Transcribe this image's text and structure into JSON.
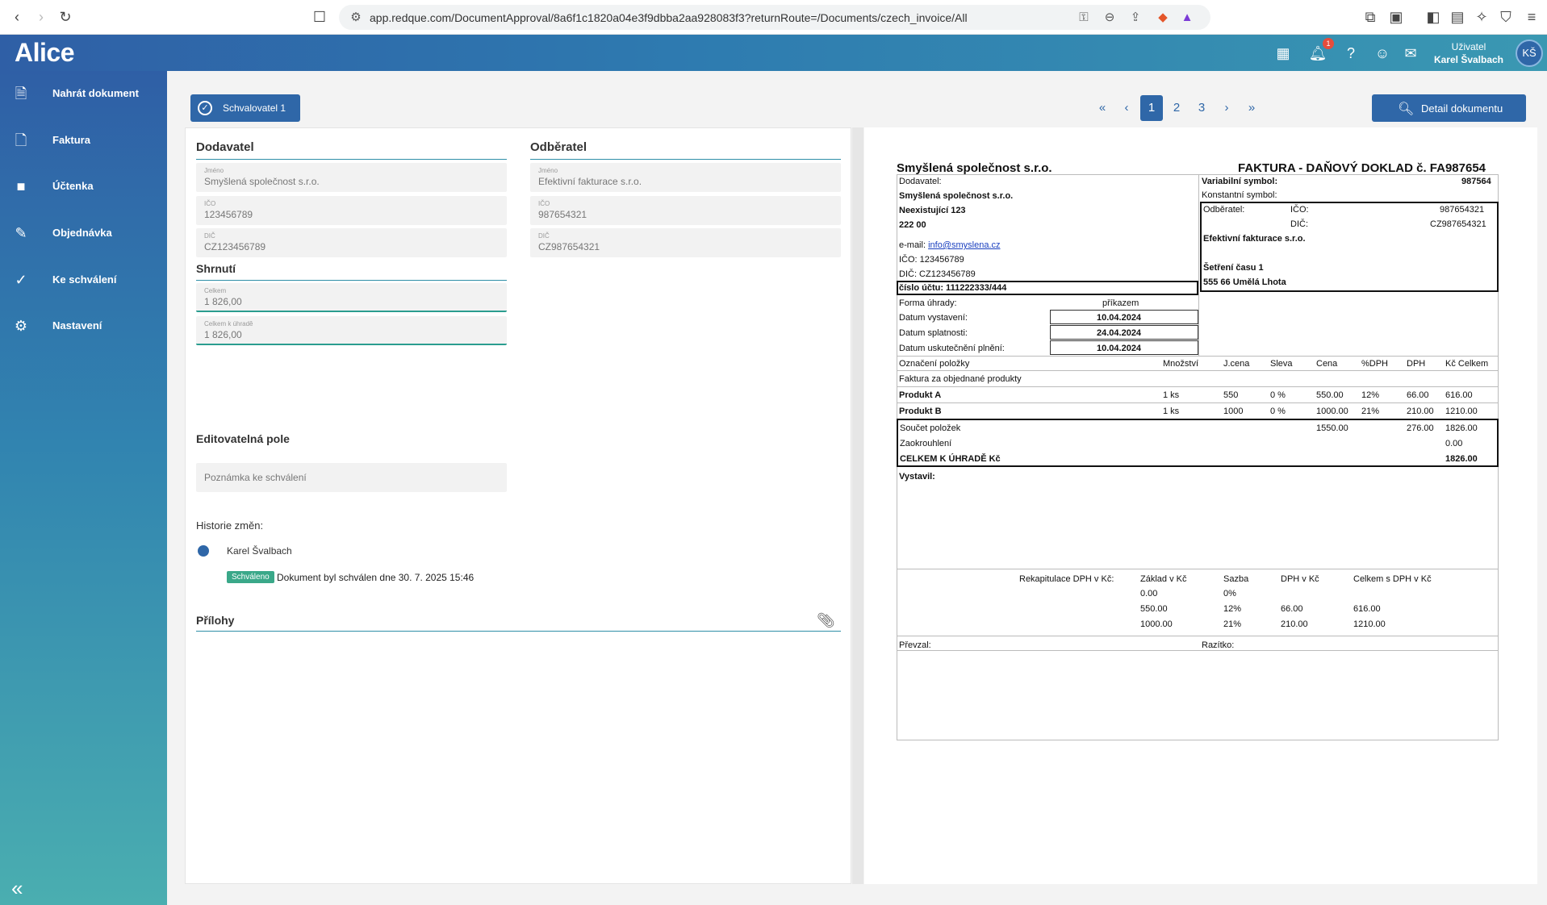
{
  "browser": {
    "url": "app.redque.com/DocumentApproval/8a6f1c1820a04e3f9dbba2aa928083f3?returnRoute=/Documents/czech_invoice/All"
  },
  "header": {
    "logo": "Alice",
    "notification_count": "1",
    "user_role": "Uživatel",
    "user_name": "Karel Švalbach",
    "user_initials": "KŠ"
  },
  "sidebar": {
    "items": [
      {
        "label": "Nahrát dokument",
        "icon": "upload-file-icon"
      },
      {
        "label": "Faktura",
        "icon": "document-icon"
      },
      {
        "label": "Účtenka",
        "icon": "receipt-icon"
      },
      {
        "label": "Objednávka",
        "icon": "order-edit-icon"
      },
      {
        "label": "Ke schválení",
        "icon": "approval-document-icon"
      },
      {
        "label": "Nastavení",
        "icon": "gear-icon"
      }
    ]
  },
  "toolbar": {
    "approver_label": "Schvalovatel 1",
    "pages": [
      "1",
      "2",
      "3"
    ],
    "active_page": "1",
    "detail_label": "Detail dokumentu"
  },
  "form": {
    "supplier": {
      "title": "Dodavatel",
      "fields": [
        {
          "label": "Jméno",
          "value": "Smyšlená společnost s.r.o."
        },
        {
          "label": "IČO",
          "value": "123456789"
        },
        {
          "label": "DIČ",
          "value": "CZ123456789"
        }
      ]
    },
    "customer": {
      "title": "Odběratel",
      "fields": [
        {
          "label": "Jméno",
          "value": "Efektivní fakturace s.r.o."
        },
        {
          "label": "IČO",
          "value": "987654321"
        },
        {
          "label": "DIČ",
          "value": "CZ987654321"
        }
      ]
    },
    "summary": {
      "title": "Shrnutí",
      "fields": [
        {
          "label": "Celkem",
          "value": "1  826,00"
        },
        {
          "label": "Celkem k úhradě",
          "value": "1  826,00"
        }
      ]
    },
    "editable": {
      "title": "Editovatelná pole",
      "note_placeholder": "Poznámka ke schválení"
    },
    "history": {
      "title": "Historie změn:",
      "user": "Karel Švalbach",
      "badge": "Schváleno",
      "message": "Dokument byl schválen dne 30. 7. 2025 15:46"
    },
    "attachments": {
      "title": "Přílohy"
    }
  },
  "invoice": {
    "company": "Smyšlená společnost s.r.o.",
    "title": "FAKTURA - DAŇOVÝ DOKLAD č. FA987654",
    "supplier_label": "Dodavatel:",
    "supplier_name": "Smyšlená společnost s.r.o.",
    "supplier_street": "Neexistující 123",
    "supplier_zip": "222 00",
    "email_label": "e-mail:",
    "email": "info@smyslena.cz",
    "ico_line": "IČO: 123456789",
    "dic_line": "DIČ: CZ123456789",
    "account": "číslo účtu: 111222333/444",
    "vs_label": "Variabilní symbol:",
    "vs_value": "987564",
    "ks_label": "Konstantní symbol:",
    "cust_label": "Odběratel:",
    "cust_ico_label": "IČO:",
    "cust_ico": "987654321",
    "cust_dic_label": "DIČ:",
    "cust_dic": "CZ987654321",
    "cust_name": "Efektivní fakturace s.r.o.",
    "cust_street": "Šetření času 1",
    "cust_city": "555 66 Umělá Lhota",
    "payment_label": "Forma úhrady:",
    "payment_value": "příkazem",
    "issue_label": "Datum vystavení:",
    "issue_date": "10.04.2024",
    "due_label": "Datum splatnosti:",
    "due_date": "24.04.2024",
    "taxable_label": "Datum uskutečnění plnění:",
    "taxable_date": "10.04.2024",
    "columns": [
      "Označení položky",
      "Množství",
      "J.cena",
      "Sleva",
      "Cena",
      "%DPH",
      "DPH",
      "Kč Celkem"
    ],
    "intro": "Faktura za objednané produkty",
    "items": [
      {
        "name": "Produkt A",
        "qty": "1 ks",
        "unit": "550",
        "disc": "0 %",
        "price": "550.00",
        "vat_pct": "12%",
        "vat": "66.00",
        "total": "616.00"
      },
      {
        "name": "Produkt B",
        "qty": "1 ks",
        "unit": "1000",
        "disc": "0 %",
        "price": "1000.00",
        "vat_pct": "21%",
        "vat": "210.00",
        "total": "1210.00"
      }
    ],
    "sum_label": "Součet položek",
    "sum_price": "1550.00",
    "sum_vat": "276.00",
    "sum_total": "1826.00",
    "round_label": "Zaokrouhlení",
    "round_value": "0.00",
    "grand_label": "CELKEM K ÚHRADĚ Kč",
    "grand_value": "1826.00",
    "issued_by": "Vystavil:",
    "recap_label": "Rekapitulace DPH v Kč:",
    "recap_columns": [
      "Základ v Kč",
      "Sazba",
      "DPH v Kč",
      "Celkem s DPH v Kč"
    ],
    "recap_rows": [
      {
        "base": "0.00",
        "rate": "0%",
        "vat": "",
        "total": ""
      },
      {
        "base": "550.00",
        "rate": "12%",
        "vat": "66.00",
        "total": "616.00"
      },
      {
        "base": "1000.00",
        "rate": "21%",
        "vat": "210.00",
        "total": "1210.00"
      }
    ],
    "received_by": "Převzal:",
    "stamp": "Razítko:"
  }
}
